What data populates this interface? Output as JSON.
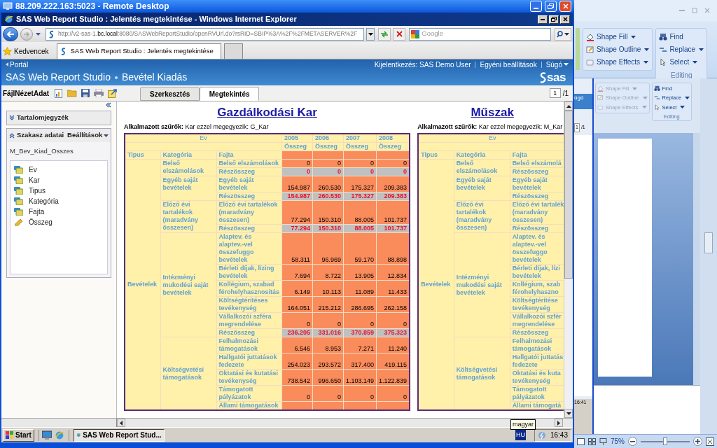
{
  "remote_window": {
    "title": "88.209.222.163:5023 - Remote Desktop"
  },
  "browser": {
    "title": "SAS Web Report Studio : Jelentés megtekintése - Windows Internet Explorer",
    "url": "http://v2-sas-1.**bc.local**:8080/SASWebReportStudio/openRVUrl.do?rsRID=SBIP%3A%2F%2FMETASERVER%2F",
    "search_placeholder": "Google",
    "favorites_label": "Kedvencek",
    "tabs": [
      {
        "label": "SAS Web Report Studio : Jelentés megtekintése",
        "selected": true
      }
    ]
  },
  "app_header": {
    "back_link": "Portál",
    "links": [
      {
        "label": "Kijelentkezés: SAS Demo User",
        "dropdown": false
      },
      {
        "label": "Egyéni beállítások",
        "dropdown": false
      },
      {
        "label": "Súgó",
        "dropdown": true
      }
    ],
    "app_name": "SAS Web Report Studio",
    "report_name": "Bevétel Kiadás",
    "logo_text": "sas"
  },
  "toolbar": {
    "menus": [
      "Fájl",
      "Nézet",
      "Adat"
    ],
    "tabs": [
      {
        "label": "Szerkesztés",
        "selected": false
      },
      {
        "label": "Megtekintés",
        "selected": true
      }
    ],
    "page": "1",
    "page_total": "/1"
  },
  "side_panel": {
    "sections": [
      {
        "title": "Tartalomjegyzék",
        "expanded": false
      },
      {
        "title": "Szakasz adatai",
        "menu": "Beállítások",
        "expanded": true
      }
    ],
    "source": "M_Bev_Kiad_Osszes",
    "items": [
      {
        "label": "Ev",
        "kind": "category"
      },
      {
        "label": "Kar",
        "kind": "category"
      },
      {
        "label": "Tipus",
        "kind": "category"
      },
      {
        "label": "Kategória",
        "kind": "category"
      },
      {
        "label": "Fajta",
        "kind": "category"
      },
      {
        "label": "Összeg",
        "kind": "measure"
      }
    ]
  },
  "reports": [
    {
      "title": "Gazdálkodási Kar",
      "filter": "**Alkalmazott szűrők:** Kar ezzel megegyezik: G_Kar",
      "header": {
        "ev": "Ev",
        "tipus": "Tipus",
        "kategoria": "Kategória",
        "fajta": "Fajta"
      },
      "years": [
        {
          "year": "2005",
          "measure": "Összeg"
        },
        {
          "year": "2006",
          "measure": "Összeg"
        },
        {
          "year": "2007",
          "measure": "Összeg"
        },
        {
          "year": "2008",
          "measure": "Összeg"
        }
      ],
      "tipus": "Bevételek",
      "groups": [
        {
          "kategoria": "Belső\nelszámolások",
          "rows": [
            {
              "kind": "detail",
              "fajta": "Belső elszámolások",
              "values": [
                "0",
                "0",
                "0",
                "0"
              ]
            },
            {
              "kind": "subtotal",
              "fajta": "Részösszeg",
              "values": [
                "0",
                "0",
                "0",
                "0"
              ]
            }
          ]
        },
        {
          "kategoria": "Egyéb saját\nbevételek",
          "rows": [
            {
              "kind": "detail",
              "fajta": "Egyéb saját\nbevételek",
              "values": [
                "154.987",
                "260.530",
                "175.327",
                "209.383"
              ]
            },
            {
              "kind": "subtotal",
              "fajta": "Részösszeg",
              "values": [
                "154.987",
                "260.530",
                "175.327",
                "209.383"
              ]
            }
          ]
        },
        {
          "kategoria": "Előző évi\ntartalékok\n(maradvány\nösszesen)",
          "rows": [
            {
              "kind": "detail",
              "fajta": "Előző évi tartalékok\n(maradvány\nösszesen)",
              "values": [
                "77.294",
                "150.310",
                "88.005",
                "101.737"
              ]
            },
            {
              "kind": "subtotal",
              "fajta": "Részösszeg",
              "values": [
                "77.294",
                "150.310",
                "88.005",
                "101.737"
              ]
            }
          ]
        },
        {
          "kategoria": "Intézményi\nmukodési saját\nbevételek",
          "rows": [
            {
              "kind": "detail",
              "fajta": "Alaptev. és\nalaptev.-vel\nösszefuggo\nbevételek",
              "values": [
                "58.311",
                "96.969",
                "59.170",
                "88.898"
              ]
            },
            {
              "kind": "detail",
              "fajta": "Bérleti díjak, lízing\nbevételek",
              "values": [
                "7.694",
                "8.722",
                "13.905",
                "12.834"
              ]
            },
            {
              "kind": "detail",
              "fajta": "Kollégium, szabad\nférohelyhasznosítás",
              "values": [
                "6.149",
                "10.113",
                "11.089",
                "11.433"
              ]
            },
            {
              "kind": "detail",
              "fajta": "Költségtérítéses\ntevékenység",
              "values": [
                "164.051",
                "215.212",
                "286.695",
                "262.158"
              ]
            },
            {
              "kind": "detail",
              "fajta": "Vállalkozói szféra\nmegrendelése",
              "values": [
                "0",
                "0",
                "0",
                "0"
              ]
            },
            {
              "kind": "subtotal",
              "fajta": "Részösszeg",
              "values": [
                "236.205",
                "331.016",
                "370.859",
                "375.323"
              ]
            }
          ]
        },
        {
          "kategoria": "Költségvetési\ntámogatások",
          "rows": [
            {
              "kind": "detail",
              "fajta": "Felhalmozási\ntámogatások",
              "values": [
                "6.546",
                "8.953",
                "7.271",
                "11.240"
              ]
            },
            {
              "kind": "detail",
              "fajta": "Hallgatói juttatások\nfedezete",
              "values": [
                "254.023",
                "293.572",
                "317.400",
                "419.115"
              ]
            },
            {
              "kind": "detail",
              "fajta": "Oktatási és kutatási\ntevékenység",
              "values": [
                "738.542",
                "996.650",
                "1.103.149",
                "1.122.839"
              ]
            },
            {
              "kind": "detail",
              "fajta": "Támogatott\npályázatok",
              "values": [
                "0",
                "0",
                "0",
                "0"
              ]
            },
            {
              "kind": "detail",
              "fajta": "Állami támogatások"
            }
          ]
        }
      ]
    },
    {
      "title": "Műszak",
      "filter": "**Alkalmazott szűrők:** Kar ezzel megegyezik: M_Kar",
      "header": {
        "ev": "Ev",
        "tipus": "Tipus",
        "kategoria": "Kategória",
        "fajta": "Fajta"
      },
      "tipus": "Bevételek",
      "groups": [
        {
          "kategoria": "Belső\nelszámolások",
          "rows": [
            {
              "kind": "detail",
              "fajta": "Belső elszámolá"
            },
            {
              "kind": "subtotal",
              "fajta": "Részösszeg"
            }
          ]
        },
        {
          "kategoria": "Egyéb saját\nbevételek",
          "rows": [
            {
              "kind": "detail",
              "fajta": "Egyéb saját\nbevételek"
            },
            {
              "kind": "subtotal",
              "fajta": "Részösszeg"
            }
          ]
        },
        {
          "kategoria": "Előző évi\ntartalékok\n(maradvány\nösszesen)",
          "rows": [
            {
              "kind": "detail",
              "fajta": "Előző évi tartalék\n(maradvány\nösszesen)"
            },
            {
              "kind": "subtotal",
              "fajta": "Részösszeg"
            }
          ]
        },
        {
          "kategoria": "Intézményi\nmukodési saját\nbevételek",
          "rows": [
            {
              "kind": "detail",
              "fajta": "Alaptev. és\nalaptev.-vel\nösszefuggo\nbevételek"
            },
            {
              "kind": "detail",
              "fajta": "Bérleti díjak, lízi\nbevételek"
            },
            {
              "kind": "detail",
              "fajta": "Kollégium, szab\nférohelyhaszno"
            },
            {
              "kind": "detail",
              "fajta": "Költségtérítése\ntevékenység"
            },
            {
              "kind": "detail",
              "fajta": "Vállalkozói szfér\nmegrendelése"
            },
            {
              "kind": "subtotal",
              "fajta": "Részösszeg"
            }
          ]
        },
        {
          "kategoria": "Költségvetési\ntámogatások",
          "rows": [
            {
              "kind": "detail",
              "fajta": "Felhalmozási\ntámogatások"
            },
            {
              "kind": "detail",
              "fajta": "Hallgatói juttatás\nfedezete"
            },
            {
              "kind": "detail",
              "fajta": "Oktatási és kuta\ntevékenység"
            },
            {
              "kind": "detail",
              "fajta": "Támogatott\npályázatok"
            },
            {
              "kind": "detail",
              "fajta": "Állami támogatá"
            }
          ]
        }
      ]
    }
  ],
  "tooltip": "magyar",
  "taskbar": {
    "start": "Start",
    "tasks": [
      "SAS Web Report Stud..."
    ],
    "language": "HU",
    "clock": "16:43"
  },
  "host_window": {
    "ribbon_groups": [
      {
        "items": [
          {
            "label": "Shape Fill",
            "dropdown": true
          },
          {
            "label": "Shape Outline",
            "dropdown": true
          },
          {
            "label": "Shape Effects",
            "dropdown": true
          }
        ]
      },
      {
        "label": "Editing",
        "items": [
          {
            "label": "Find",
            "dropdown": false
          },
          {
            "label": "Replace",
            "dropdown": true
          },
          {
            "label": "Select",
            "dropdown": true
          }
        ]
      }
    ],
    "inner_ribbon_groups": [
      {
        "disabled": true,
        "items": [
          {
            "label": "Shape Fill",
            "dropdown": true
          },
          {
            "label": "Shape Outline",
            "dropdown": true
          },
          {
            "label": "Shape Effects",
            "dropdown": true
          }
        ]
      },
      {
        "disabled": false,
        "label": "Editing",
        "items": [
          {
            "label": "Find",
            "dropdown": false
          },
          {
            "label": "Replace",
            "dropdown": true
          },
          {
            "label": "Select",
            "dropdown": true
          }
        ]
      }
    ],
    "inner_strip": {
      "help": "úgó",
      "page": "1",
      "page_total": "/1",
      "clock": "16:41"
    },
    "zoom": "75%"
  }
}
